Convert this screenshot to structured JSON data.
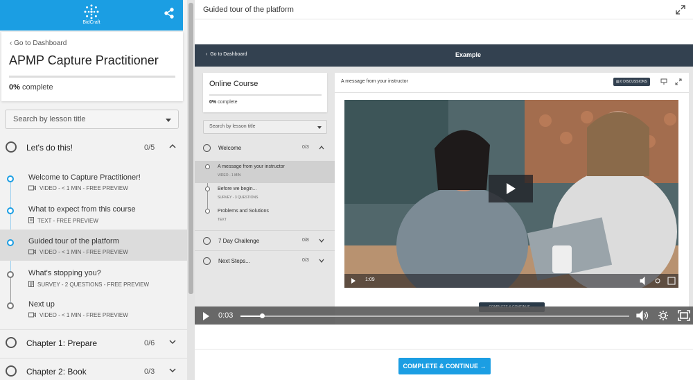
{
  "brand": {
    "name": "BidCraft",
    "color": "#1b9ee3"
  },
  "sidebar": {
    "goto_dashboard": "Go to Dashboard",
    "course_title": "APMP Capture Practitioner",
    "progress_pct": "0%",
    "progress_label": "complete",
    "progress_value": 0,
    "search_placeholder": "Search by lesson title",
    "sections": [
      {
        "title": "Let's do this!",
        "count": "0/5",
        "expanded": true,
        "lessons": [
          {
            "title": "Welcome to Capture Practitioner!",
            "meta": "VIDEO - < 1 MIN - FREE PREVIEW",
            "icon": "video-icon"
          },
          {
            "title": "What to expect from this course",
            "meta": "TEXT - FREE PREVIEW",
            "icon": "text-icon"
          },
          {
            "title": "Guided tour of the platform",
            "meta": "VIDEO - < 1 MIN - FREE PREVIEW",
            "icon": "video-icon",
            "active": true
          },
          {
            "title": "What's stopping you?",
            "meta": "SURVEY - 2 QUESTIONS - FREE PREVIEW",
            "icon": "survey-icon"
          },
          {
            "title": "Next up",
            "meta": "VIDEO - < 1 MIN - FREE PREVIEW",
            "icon": "video-icon"
          }
        ]
      },
      {
        "title": "Chapter 1: Prepare",
        "count": "0/6",
        "expanded": false
      },
      {
        "title": "Chapter 2: Book",
        "count": "0/3",
        "expanded": false
      }
    ]
  },
  "main": {
    "title": "Guided tour of the platform",
    "complete_button": "COMPLETE & CONTINUE →",
    "video": {
      "time": "0:03",
      "progress": 0.055
    }
  },
  "inner": {
    "goto_dashboard": "Go to Dashboard",
    "header_title": "Example",
    "course_title": "Online Course",
    "progress_pct": "0%",
    "progress_label": "complete",
    "search_placeholder": "Search by lesson title",
    "sections": [
      {
        "title": "Welcome",
        "count": "0/3",
        "lessons": [
          {
            "title": "A message from your instructor",
            "meta": "VIDEO - 1 MIN",
            "active": true
          },
          {
            "title": "Before we begin...",
            "meta": "SURVEY - 3 QUESTIONS"
          },
          {
            "title": "Problems and Solutions",
            "meta": "TEXT"
          }
        ]
      },
      {
        "title": "7 Day Challenge",
        "count": "0/8"
      },
      {
        "title": "Next Steps...",
        "count": "0/3"
      }
    ],
    "panel_title": "A message from your instructor",
    "discussions": "0 DISCUSSIONS",
    "video_time": "1:09",
    "complete_button": "COMPLETE & CONTINUE →"
  }
}
